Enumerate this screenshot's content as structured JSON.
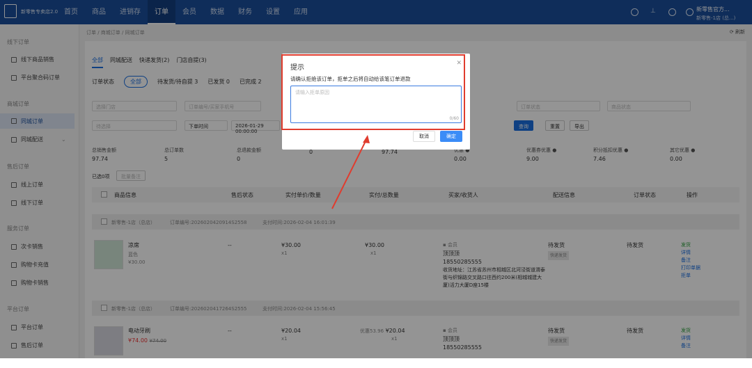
{
  "header": {
    "brand": "新零售专卖店2.0",
    "nav": [
      "首页",
      "商品",
      "进销存",
      "订单",
      "会员",
      "数据",
      "财务",
      "设置",
      "应用"
    ],
    "shop_name": "新零售官方...",
    "shop_sub": "新零售-1店 (总...)"
  },
  "sidebar": {
    "groups": [
      {
        "title": "线下订单",
        "items": [
          "线下商品销售",
          "平台聚合码订单"
        ]
      },
      {
        "title": "商城订单",
        "items": [
          "同城订单",
          "同城配送"
        ]
      },
      {
        "title": "售后订单",
        "items": [
          "线上订单",
          "线下订单"
        ]
      },
      {
        "title": "服务订单",
        "items": [
          "次卡销售",
          "购物卡充值",
          "购物卡销售"
        ]
      },
      {
        "title": "平台订单",
        "items": [
          "平台订单",
          "售后订单"
        ]
      }
    ]
  },
  "main": {
    "breadcrumb": "订单 / 商城订单 / 同城订单",
    "refresh": "刷新",
    "tabs": [
      "全部",
      "同城配送",
      "快递发货(2)",
      "门店自提(3)"
    ],
    "status_label": "订单状态",
    "status_options": [
      "全部",
      "待发货/待自提 3",
      "已发货 0",
      "已完成 2"
    ],
    "filters": {
      "store": "选择门店",
      "order_no": "订单编号/买家手机号",
      "order_status": "订单状态",
      "more": "商品状态",
      "payment": "待选择",
      "time_type": "下单时间",
      "date": "2026-01-29 00:00:00"
    },
    "buttons": {
      "search": "查询",
      "reset": "重置",
      "export": "导出"
    },
    "summary": [
      {
        "label": "总销售金额",
        "value": "97.74"
      },
      {
        "label": "总订单数",
        "value": "5"
      },
      {
        "label": "总退款金额",
        "value": "0"
      },
      {
        "label": "",
        "value": "0"
      },
      {
        "label": "",
        "value": "97.74"
      },
      {
        "label": "优惠 ●",
        "value": "0.00"
      },
      {
        "label": "优惠券优惠 ●",
        "value": "9.00"
      },
      {
        "label": "积分抵扣优惠 ●",
        "value": "7.46"
      },
      {
        "label": "其它优惠 ●",
        "value": "0.00"
      }
    ],
    "selected": "已选0项",
    "batch": "批量备注",
    "columns": [
      "商品信息",
      "售后状态",
      "实付单价/数量",
      "实付/总数量",
      "买家/收货人",
      "配送信息",
      "订单状态",
      "操作"
    ]
  },
  "orders": [
    {
      "store": "新零售-1店（总店）",
      "order_no": "订单编号:2026020420914S2558",
      "pay_time": "支付时间:2026-02-04 16:01:39",
      "product": "凉席",
      "spec": "蓝色",
      "price_small": "¥30.00",
      "after_sale": "--",
      "unit_price": "¥30.00",
      "qty": "x1",
      "paid": "¥30.00",
      "paid_qty": "x1",
      "member": "会员",
      "buyer": "顶顶顶",
      "phone": "18550285555",
      "address": "收货地址：江苏省苏州市相城区北河泾街道渭泰街与织锦路交叉路口往西约200米(相城城建大厦)活力大厦D座15楼",
      "ship": "待发货",
      "ship_tag": "快递发货",
      "status": "待发货",
      "actions": [
        "发货",
        "详情",
        "备注",
        "打印单据",
        "拒单"
      ]
    },
    {
      "store": "新零售-1店（总店）",
      "order_no": "订单编号:2026020417264S2555",
      "pay_time": "支付时间:2026-02-04 15:56:45",
      "product": "电动牙刷",
      "price_now": "¥74.00",
      "price_old": "¥74.00",
      "after_sale": "--",
      "unit_price": "¥20.04",
      "qty": "x1",
      "paid_note": "优惠53.96",
      "paid": "¥20.04",
      "paid_qty": "x1",
      "member": "会员",
      "buyer": "顶顶顶",
      "phone": "18550285555",
      "ship": "待发货",
      "ship_tag": "快递发货",
      "status": "待发货",
      "actions": [
        "发货",
        "详情",
        "备注"
      ]
    }
  ],
  "dialog": {
    "title": "提示",
    "message": "请确认拒绝该订单，拒单之后将自动给该笔订单退款",
    "placeholder": "请输入拒单原因",
    "counter": "0/60",
    "cancel": "取消",
    "confirm": "确定"
  },
  "colors": {
    "topbar": "#1a4f9c",
    "accent": "#1a6fe0",
    "highlight": "#e03c2e"
  }
}
